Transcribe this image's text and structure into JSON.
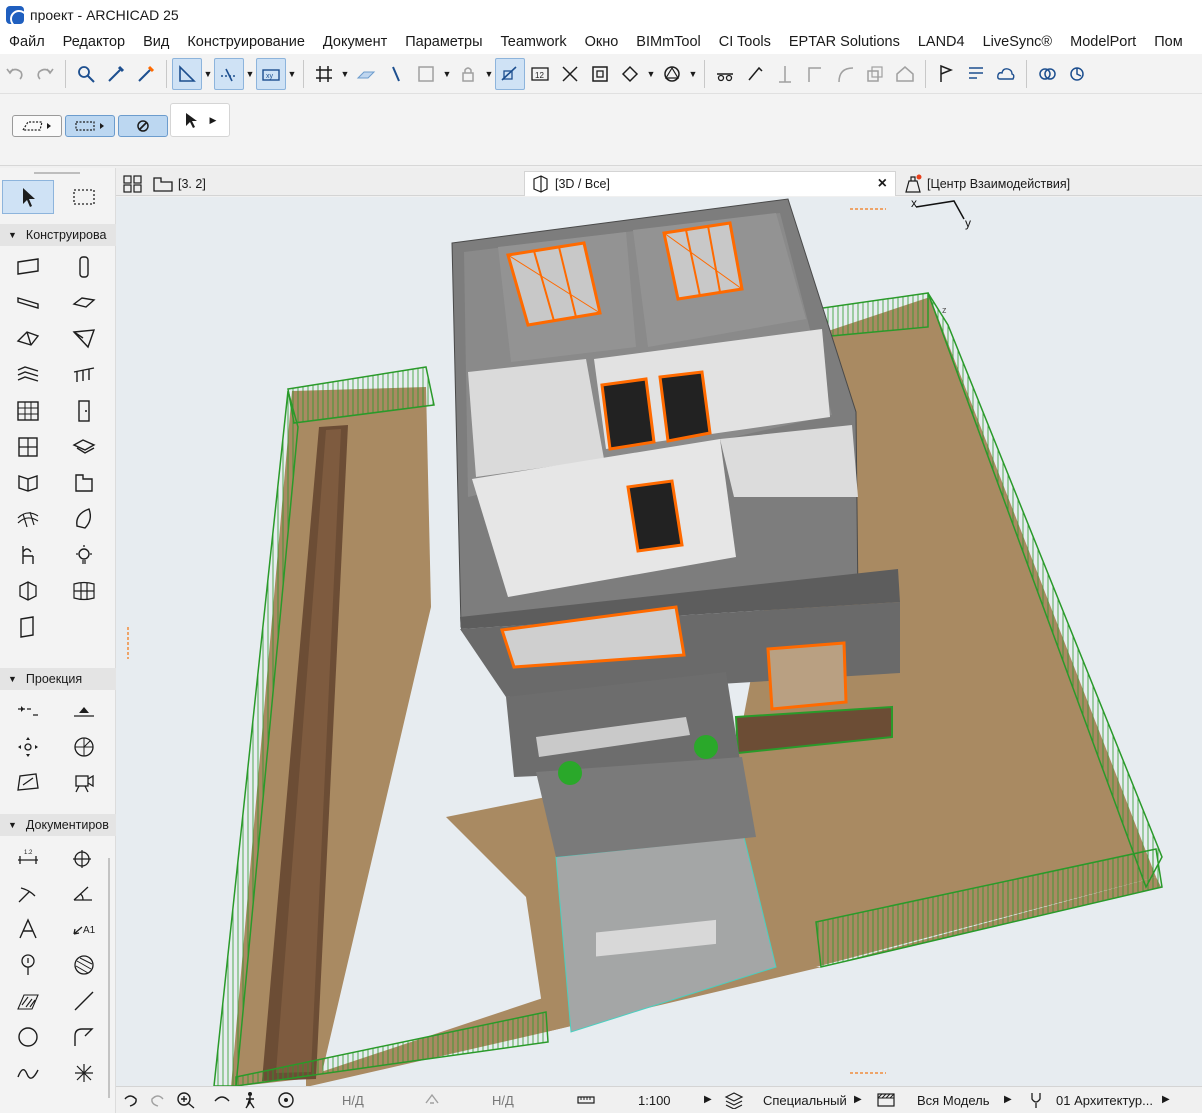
{
  "window": {
    "title": "проект - ARCHICAD 25"
  },
  "menu": [
    "Файл",
    "Редактор",
    "Вид",
    "Конструирование",
    "Документ",
    "Параметры",
    "Teamwork",
    "Окно",
    "BIMmTool",
    "CI Tools",
    "EPTAR Solutions",
    "LAND4",
    "LiveSync®",
    "ModelPort",
    "Пом"
  ],
  "sidebar": {
    "sections": [
      {
        "label": "Конструирова"
      },
      {
        "label": "Проекция"
      },
      {
        "label": "Документиров"
      }
    ]
  },
  "tabs": {
    "plan": "[3. 2]",
    "view3d": "[3D / Все]",
    "close": "×",
    "collab": "[Центр Взаимодействия]"
  },
  "axes": {
    "x": "x",
    "y": "y",
    "z": "z"
  },
  "status": {
    "nd1": "Н/Д",
    "nd2": "Н/Д",
    "scale": "1:100",
    "layer_combo": "Специальный",
    "model_view": "Вся Модель",
    "pen_set": "01 Архитектур..."
  },
  "colors": {
    "accent_orange": "#ff6a00",
    "railing_green": "#2a9a2a",
    "ground_brown": "#a98a62"
  }
}
